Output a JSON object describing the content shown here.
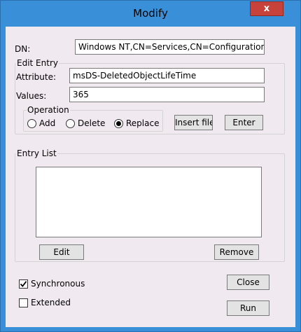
{
  "window": {
    "title": "Modify",
    "close_glyph": "x"
  },
  "dn": {
    "label": "DN:",
    "value": "Windows NT,CN=Services,CN=Configuration"
  },
  "edit_entry": {
    "group_label": "Edit Entry",
    "attribute_label": "Attribute:",
    "attribute_value": "msDS-DeletedObjectLifeTime",
    "values_label": "Values:",
    "values_value": "365",
    "operation": {
      "group_label": "Operation",
      "add_label": "Add",
      "delete_label": "Delete",
      "replace_label": "Replace",
      "selected": "Replace"
    },
    "insert_file_label": "Insert file",
    "enter_label": "Enter"
  },
  "entry_list": {
    "group_label": "Entry List",
    "items": [],
    "edit_label": "Edit",
    "remove_label": "Remove"
  },
  "options": {
    "synchronous_label": "Synchronous",
    "synchronous_checked": true,
    "extended_label": "Extended",
    "extended_checked": false
  },
  "buttons": {
    "close_label": "Close",
    "run_label": "Run"
  },
  "colors": {
    "title_bar": "#3a8fd9",
    "client_bg": "#f1e9f0",
    "close_red": "#c7423a"
  }
}
